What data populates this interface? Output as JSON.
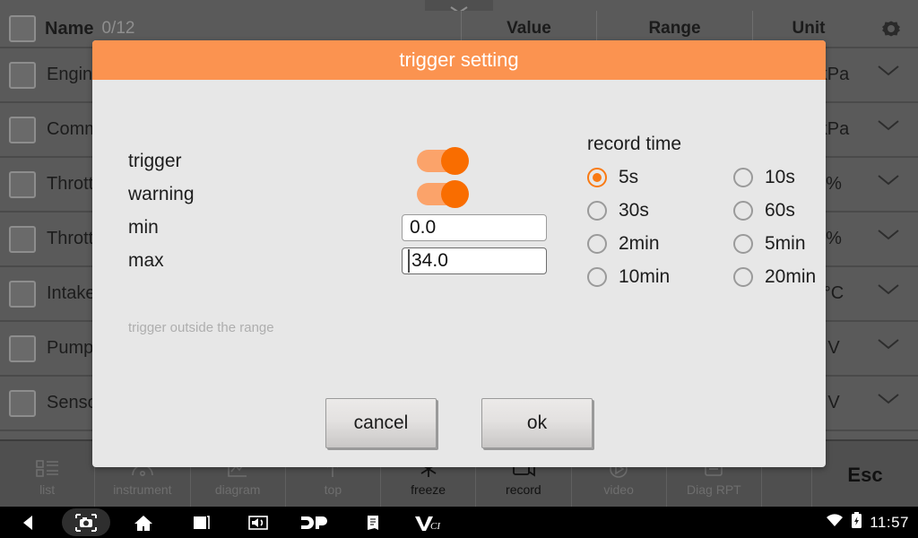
{
  "table": {
    "pull_tab_icon": "chevron-down-icon",
    "header": {
      "name": "Name",
      "count": "0/12",
      "value": "Value",
      "range": "Range",
      "unit": "Unit",
      "settings_icon": "gear-icon"
    },
    "rows": [
      {
        "name": "Engine",
        "unit": "kPa",
        "expand_icon": "chevron-down-icon"
      },
      {
        "name": "Comm",
        "unit": "kPa",
        "expand_icon": "chevron-down-icon"
      },
      {
        "name": "Thrott",
        "unit": "%",
        "expand_icon": "chevron-down-icon"
      },
      {
        "name": "Thrott",
        "unit": "%",
        "expand_icon": "chevron-down-icon"
      },
      {
        "name": "Intake",
        "unit": "°C",
        "expand_icon": "chevron-down-icon"
      },
      {
        "name": "Pump",
        "unit": "V",
        "expand_icon": "chevron-down-icon"
      },
      {
        "name": "Senso",
        "unit": "V",
        "expand_icon": "chevron-down-icon"
      }
    ]
  },
  "function_bar": {
    "items": [
      {
        "label": "list",
        "icon": "list-icon",
        "enabled": false
      },
      {
        "label": "instrument",
        "icon": "gauge-icon",
        "enabled": false
      },
      {
        "label": "diagram",
        "icon": "graph-icon",
        "enabled": false
      },
      {
        "label": "top",
        "icon": "arrow-up-icon",
        "enabled": false
      },
      {
        "label": "freeze",
        "icon": "snowflake-icon",
        "enabled": true
      },
      {
        "label": "record",
        "icon": "record-icon",
        "enabled": true
      },
      {
        "label": "video",
        "icon": "video-icon",
        "enabled": false
      },
      {
        "label": "Diag RPT",
        "icon": "report-icon",
        "enabled": false
      }
    ],
    "esc": "Esc"
  },
  "navbar": {
    "buttons": [
      {
        "icon": "back-icon",
        "selected": false
      },
      {
        "icon": "screenshot-camera-icon",
        "selected": true
      },
      {
        "icon": "home-icon",
        "selected": false
      },
      {
        "icon": "recents-icon",
        "selected": false
      },
      {
        "icon": "volume-icon",
        "selected": false
      },
      {
        "icon": "dp-logo-icon",
        "selected": false
      },
      {
        "icon": "manual-book-icon",
        "selected": false
      },
      {
        "icon": "vci-logo-icon",
        "selected": false
      }
    ],
    "status": {
      "wifi_icon": "wifi-icon",
      "battery_icon": "battery-charging-icon",
      "clock": "11:57"
    }
  },
  "dialog": {
    "title": "trigger setting",
    "trigger_label": "trigger",
    "trigger_on": true,
    "warning_label": "warning",
    "warning_on": true,
    "min_label": "min",
    "min_value": "0.0",
    "max_label": "max",
    "max_value": "34.0",
    "hint": "trigger outside the range",
    "record_time_label": "record time",
    "record_time_options": [
      {
        "label": "5s",
        "selected": true
      },
      {
        "label": "10s",
        "selected": false
      },
      {
        "label": "30s",
        "selected": false
      },
      {
        "label": "60s",
        "selected": false
      },
      {
        "label": "2min",
        "selected": false
      },
      {
        "label": "5min",
        "selected": false
      },
      {
        "label": "10min",
        "selected": false
      },
      {
        "label": "20min",
        "selected": false
      }
    ],
    "cancel_label": "cancel",
    "ok_label": "ok"
  },
  "colors": {
    "accent_orange": "#fb9350",
    "toggle_thumb": "#f96d00",
    "radio_on": "#f97a13",
    "dialog_bg": "#e7e7e7",
    "table_bg": "#5a5a5a"
  }
}
